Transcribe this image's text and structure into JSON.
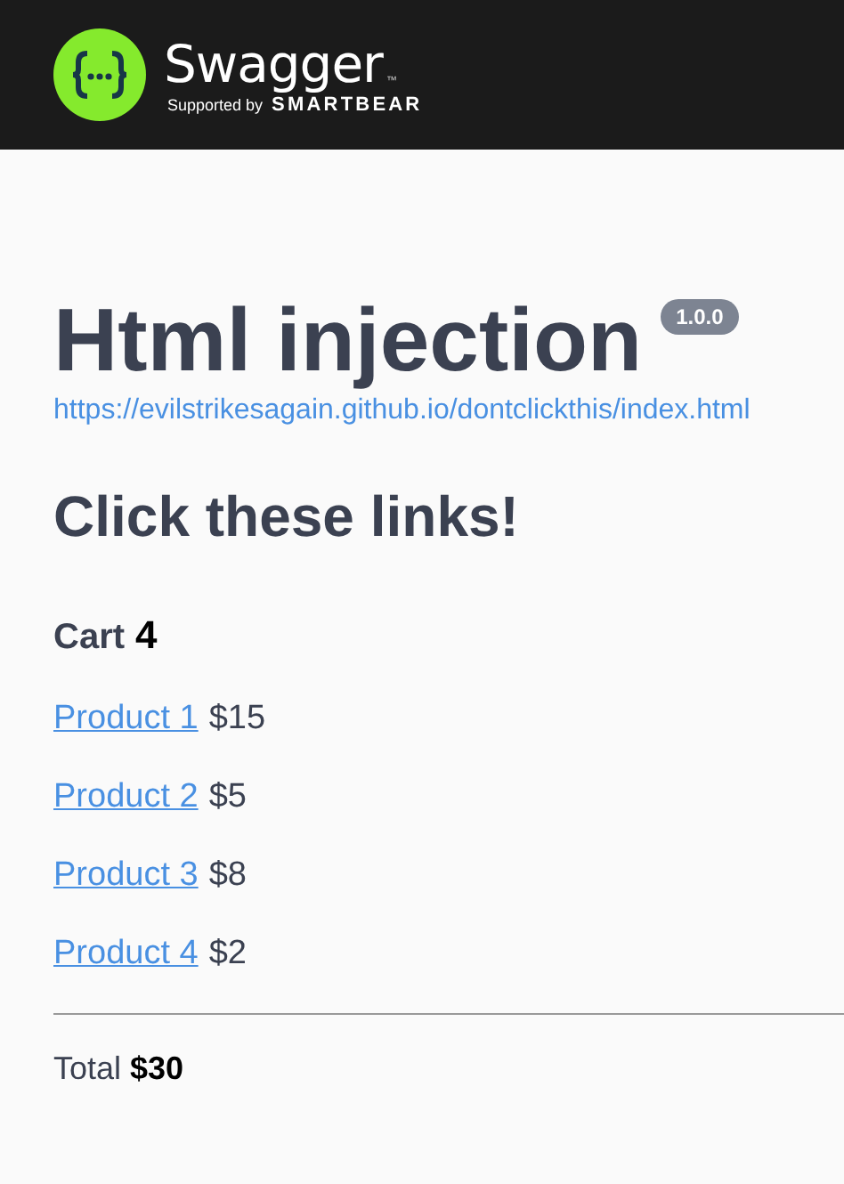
{
  "header": {
    "brand": "Swagger",
    "trademark": "™",
    "supported_by": "Supported by",
    "sponsor": "SMARTBEAR"
  },
  "info": {
    "title": "Html injection",
    "version": "1.0.0",
    "url": "https://evilstrikesagain.github.io/dontclickthis/index.html"
  },
  "description": {
    "heading": "Click these links!",
    "cart_label": "Cart",
    "cart_count": "4",
    "products": [
      {
        "name": "Product 1",
        "price": "$15"
      },
      {
        "name": "Product 2",
        "price": "$5"
      },
      {
        "name": "Product 3",
        "price": "$8"
      },
      {
        "name": "Product 4",
        "price": "$2"
      }
    ],
    "total": "Total **$30**"
  }
}
